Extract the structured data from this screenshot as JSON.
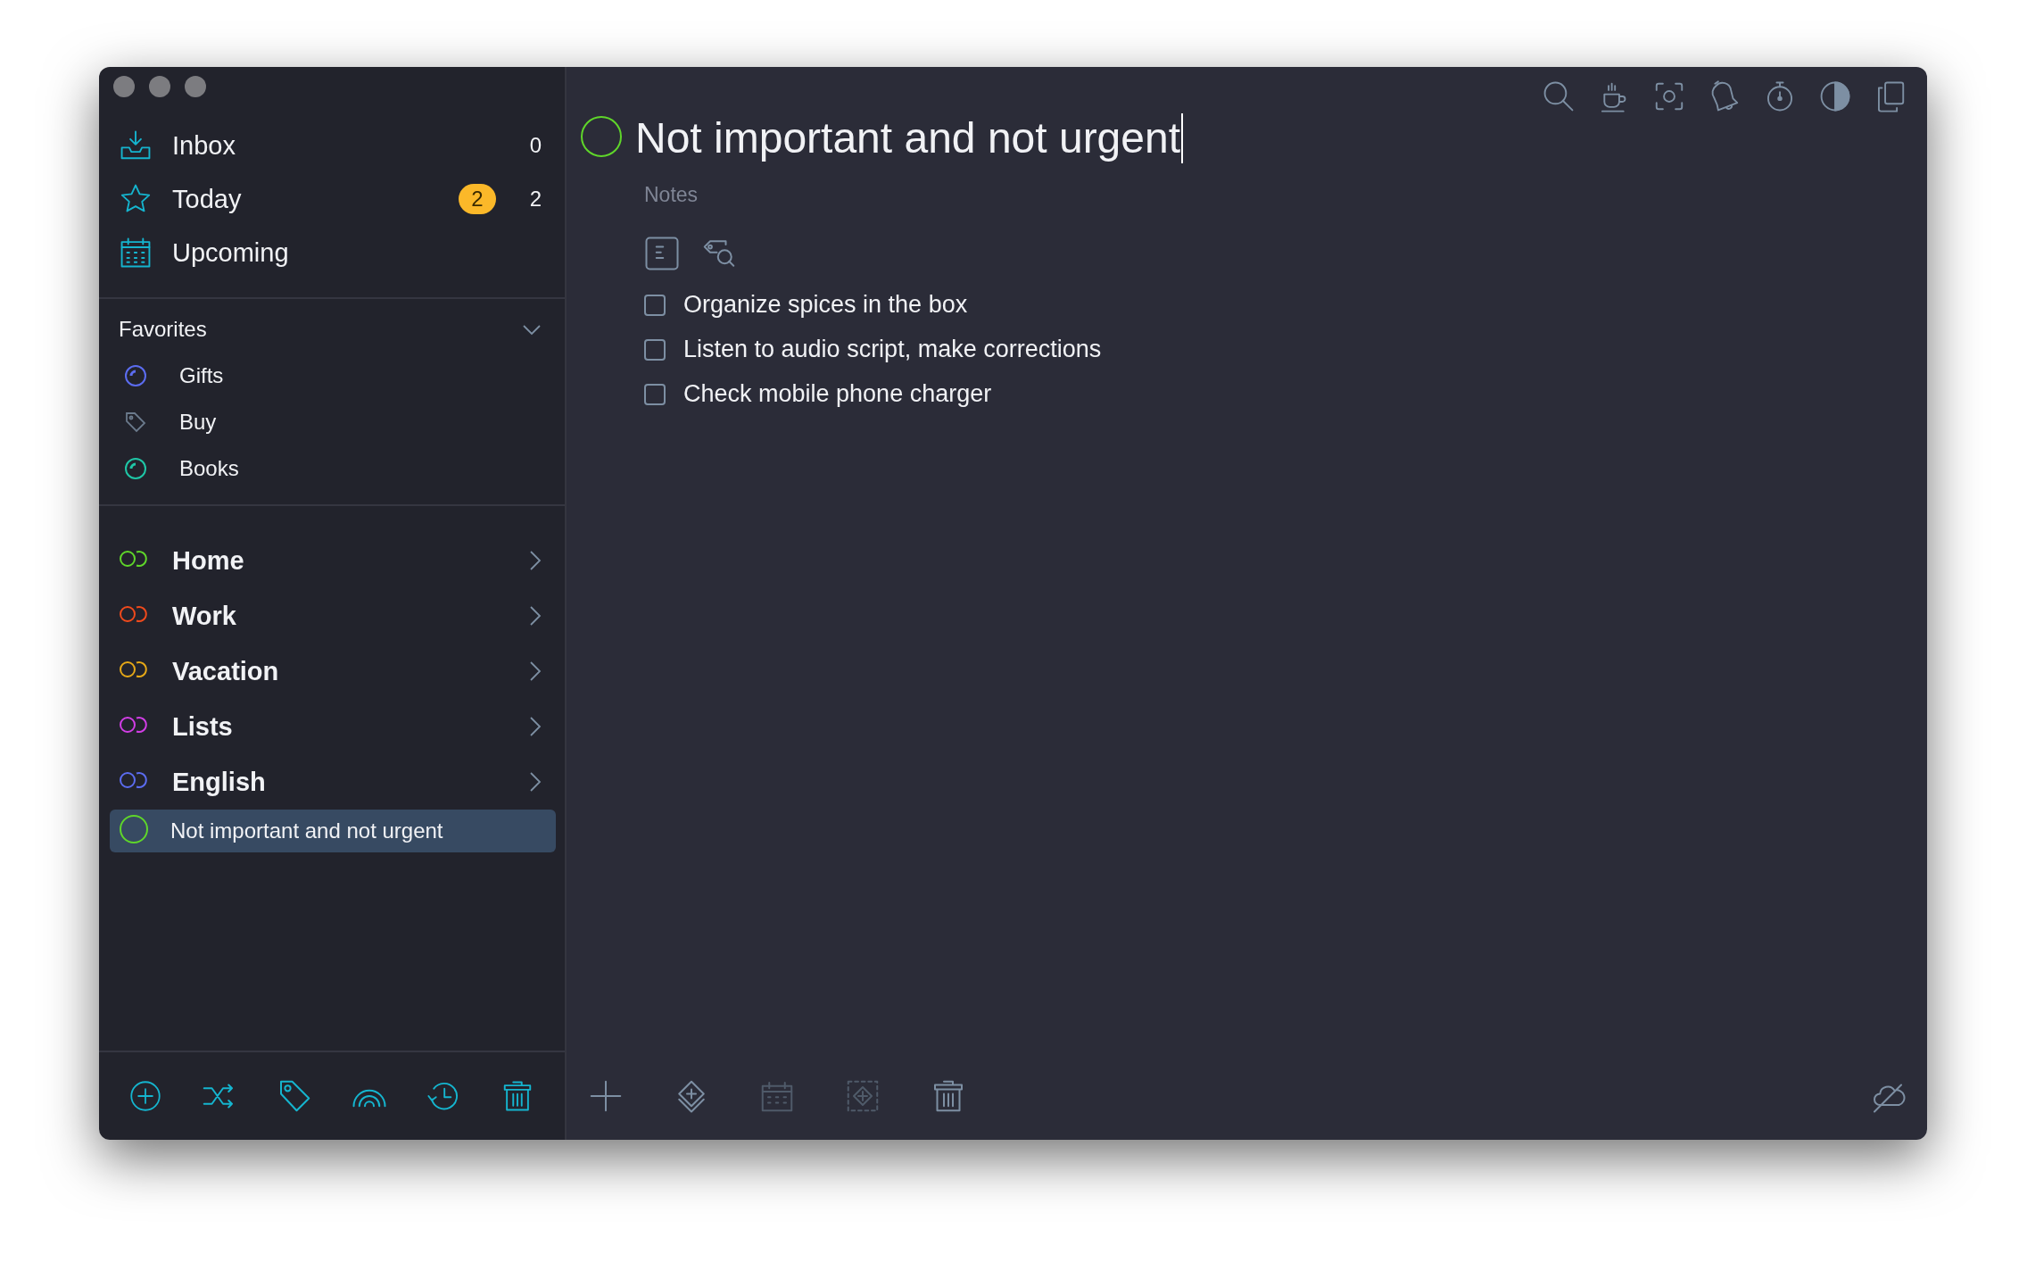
{
  "sidebar": {
    "smart_lists": [
      {
        "kind": "inbox",
        "label": "Inbox",
        "count": "0"
      },
      {
        "kind": "today",
        "label": "Today",
        "badge": "2",
        "count": "2"
      },
      {
        "kind": "upcoming",
        "label": "Upcoming"
      }
    ],
    "favorites": {
      "title": "Favorites",
      "expanded": true,
      "items": [
        {
          "kind": "area",
          "label": "Gifts",
          "color": "#5b6cf0"
        },
        {
          "kind": "tag",
          "label": "Buy",
          "color": "#6b7a8c"
        },
        {
          "kind": "area",
          "label": "Books",
          "color": "#1fc6a6"
        }
      ]
    },
    "projects": [
      {
        "kind": "group",
        "label": "Home",
        "color": "#5fd62a",
        "selected": false
      },
      {
        "kind": "group",
        "label": "Work",
        "color": "#f04a1c",
        "selected": false
      },
      {
        "kind": "group",
        "label": "Vacation",
        "color": "#e6a817",
        "selected": false
      },
      {
        "kind": "group",
        "label": "Lists",
        "color": "#d23ee6",
        "selected": false
      },
      {
        "kind": "group",
        "label": "English",
        "color": "#5b6cf0",
        "selected": false
      },
      {
        "kind": "list",
        "label": "Not important and not urgent",
        "color": "#5fd62a",
        "selected": true
      }
    ]
  },
  "task": {
    "title": "Not important and not urgent",
    "color": "#5fd62a",
    "notes": {
      "placeholder": "Notes"
    },
    "checklist": [
      {
        "text": "Organize spices in the box",
        "checked": false
      },
      {
        "text": "Listen to audio script, make corrections",
        "checked": false
      },
      {
        "text": "Check mobile phone charger",
        "checked": false
      }
    ]
  }
}
